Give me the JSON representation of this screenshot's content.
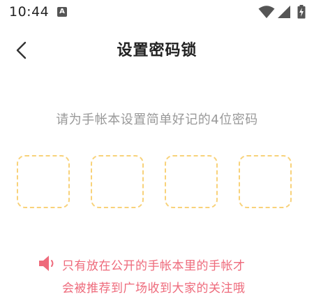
{
  "status_bar": {
    "time": "10:44",
    "notification_letter": "A"
  },
  "header": {
    "title": "设置密码锁"
  },
  "instruction": "请为手帐本设置简单好记的4位密码",
  "code_slots": [
    "",
    "",
    "",
    ""
  ],
  "notice": {
    "line1": "只有放在公开的手帐本里的手帐才",
    "line2": "会被推荐到广场收到大家的关注哦"
  },
  "colors": {
    "accent_dashed_border": "#f8d27a",
    "notice_text": "#ee6a7b",
    "instruction_text": "#999999",
    "title_text": "#222222"
  },
  "icons": {
    "back": "chevron-left-icon",
    "speaker": "speaker-icon",
    "wifi": "wifi-icon",
    "signal": "signal-icon",
    "battery": "battery-charging-icon"
  }
}
